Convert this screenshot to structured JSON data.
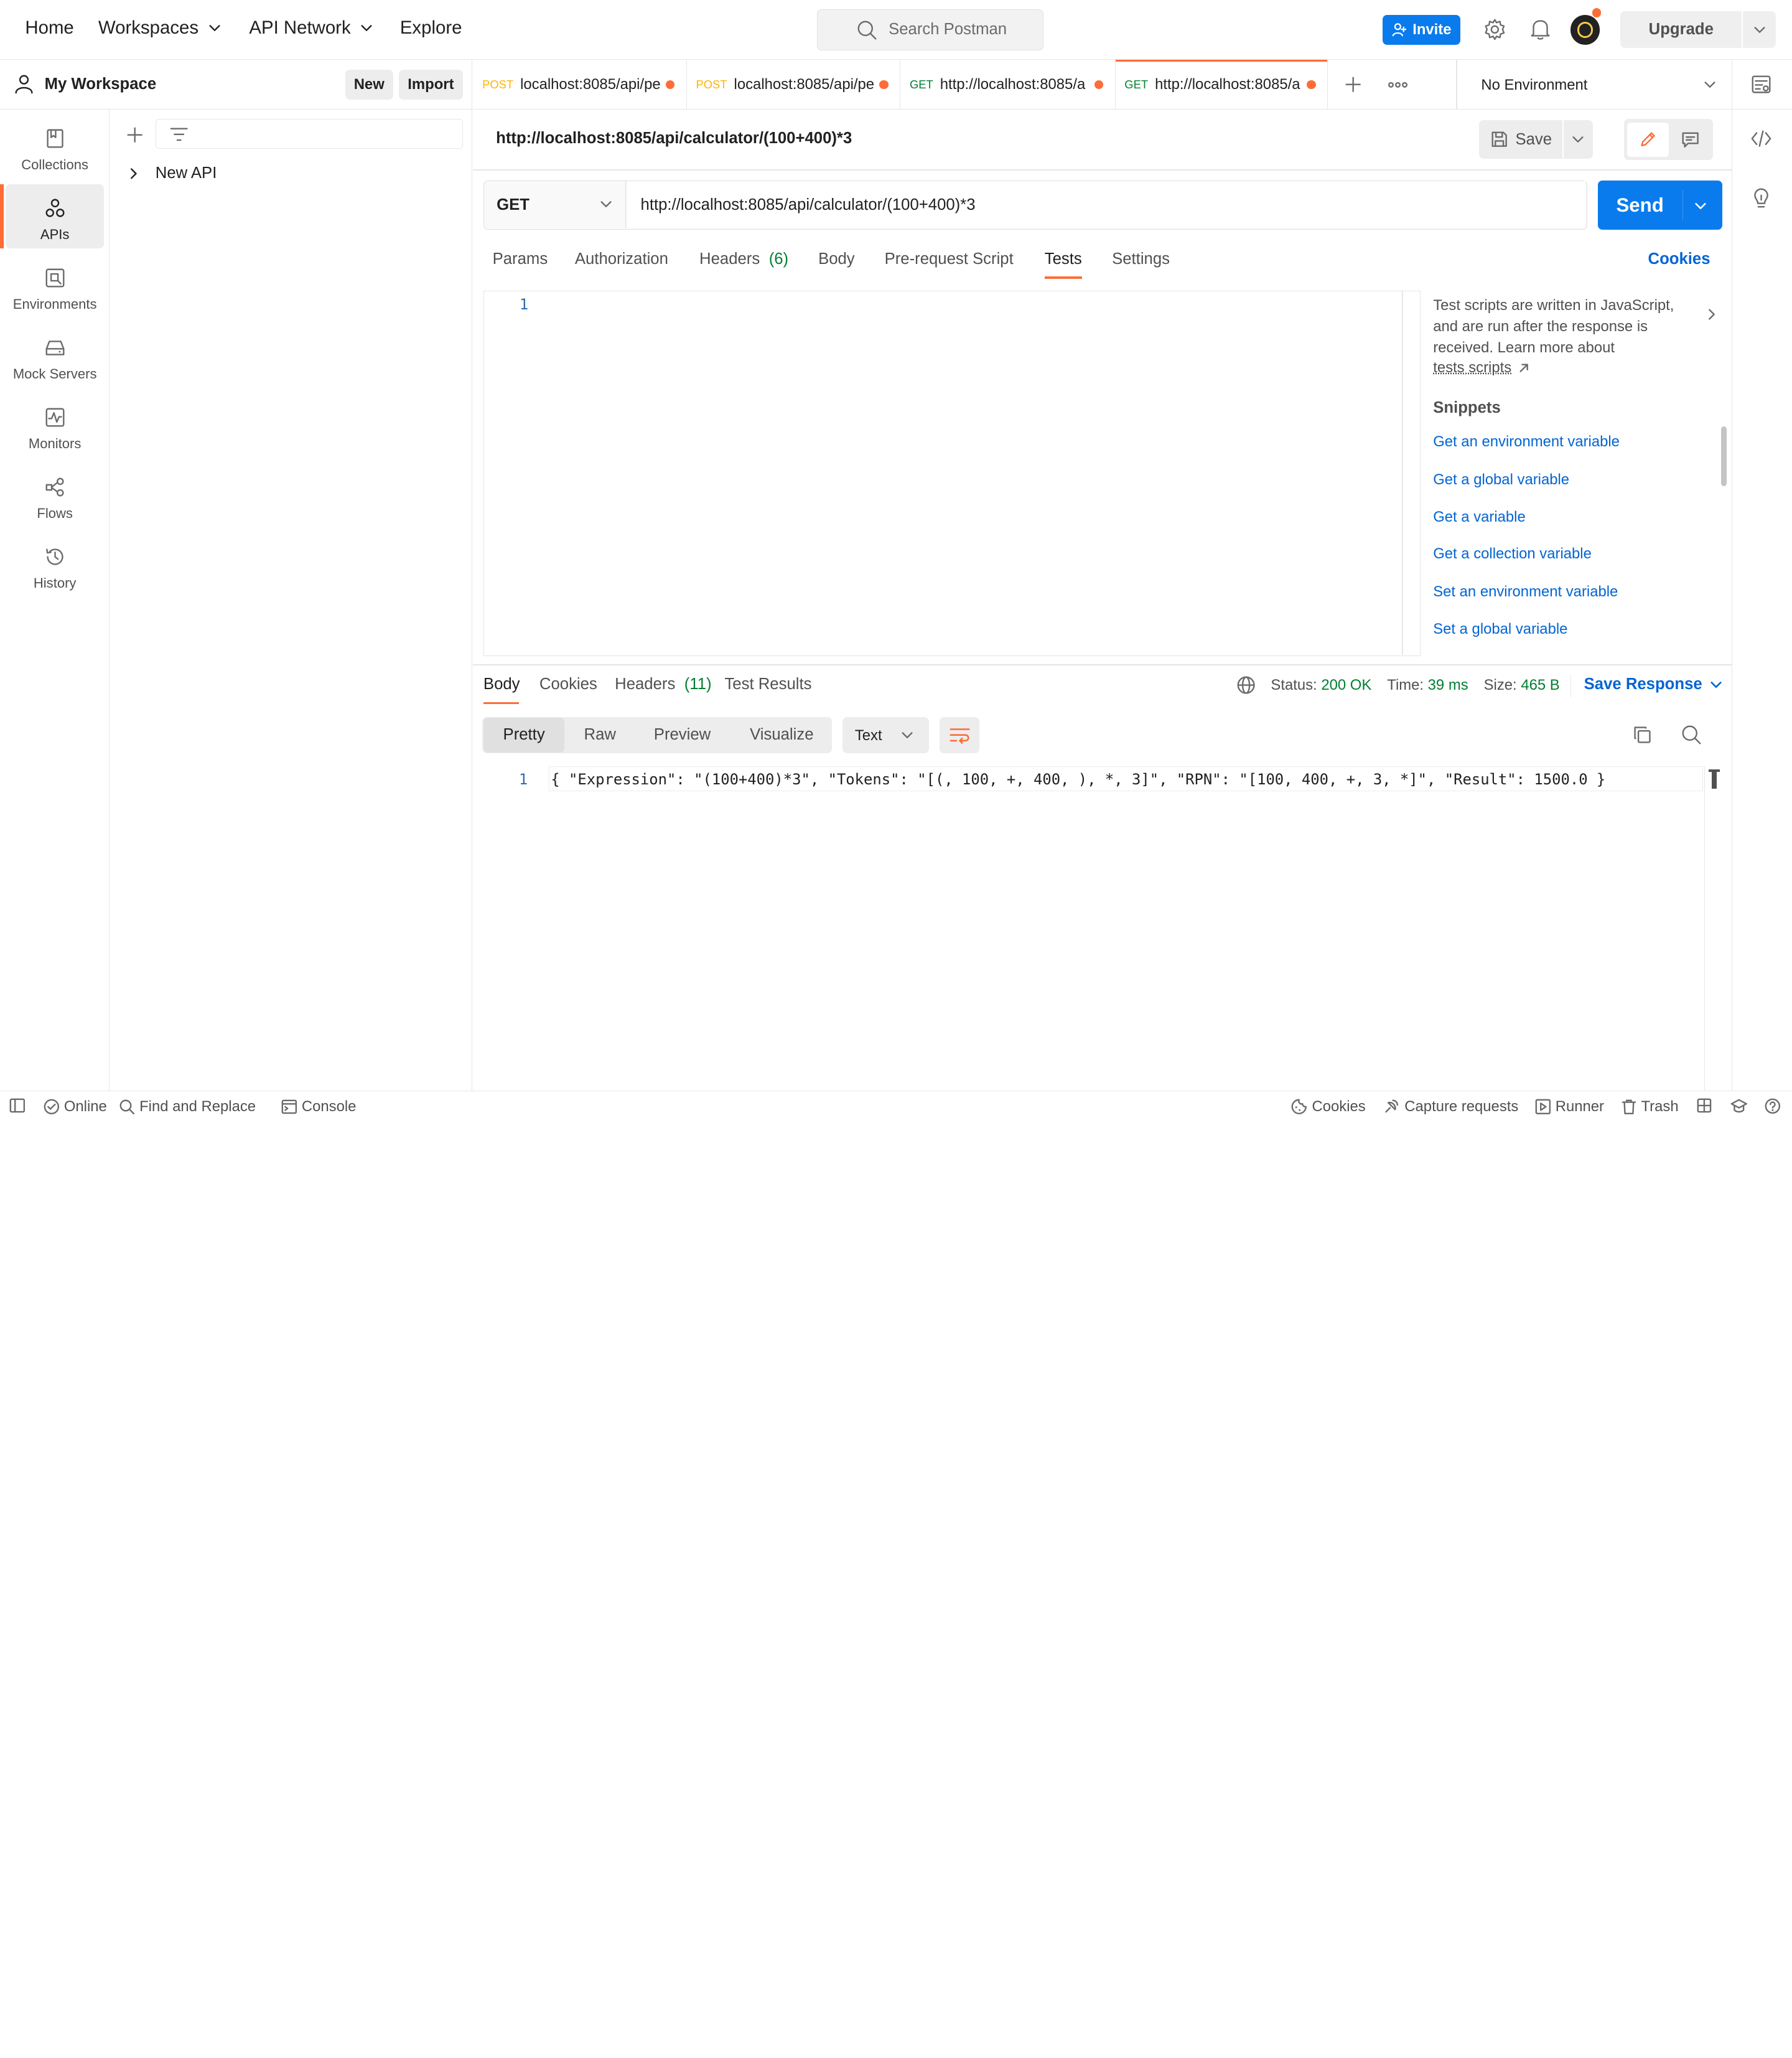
{
  "topbar": {
    "home": "Home",
    "workspaces": "Workspaces",
    "api_network": "API Network",
    "explore": "Explore",
    "search_placeholder": "Search Postman",
    "invite": "Invite",
    "upgrade": "Upgrade"
  },
  "workspace": {
    "title": "My Workspace",
    "new_label": "New",
    "import_label": "Import"
  },
  "rail": [
    {
      "label": "Collections",
      "icon": "collections-icon"
    },
    {
      "label": "APIs",
      "icon": "apis-icon"
    },
    {
      "label": "Environments",
      "icon": "environments-icon"
    },
    {
      "label": "Mock Servers",
      "icon": "mock-servers-icon"
    },
    {
      "label": "Monitors",
      "icon": "monitors-icon"
    },
    {
      "label": "Flows",
      "icon": "flows-icon"
    },
    {
      "label": "History",
      "icon": "history-icon"
    }
  ],
  "tree": {
    "item": "New API"
  },
  "tabs": [
    {
      "method": "POST",
      "label": "localhost:8085/api/pe"
    },
    {
      "method": "POST",
      "label": "localhost:8085/api/pe"
    },
    {
      "method": "GET",
      "label": "http://localhost:8085/a"
    },
    {
      "method": "GET",
      "label": "http://localhost:8085/a"
    }
  ],
  "environment": "No Environment",
  "request": {
    "title": "http://localhost:8085/api/calculator/(100+400)*3",
    "save_label": "Save",
    "method": "GET",
    "url": "http://localhost:8085/api/calculator/(100+400)*3",
    "send_label": "Send",
    "subtabs": {
      "params": "Params",
      "authorization": "Authorization",
      "headers": "Headers",
      "headers_count": "(6)",
      "body": "Body",
      "prerequest": "Pre-request Script",
      "tests": "Tests",
      "settings": "Settings",
      "cookies": "Cookies"
    },
    "editor_line": "1"
  },
  "help": {
    "text": "Test scripts are written in JavaScript, and are run after the response is received. Learn more about",
    "link": "tests scripts",
    "snippets_title": "Snippets",
    "snippets": [
      "Get an environment variable",
      "Get a global variable",
      "Get a variable",
      "Get a collection variable",
      "Set an environment variable",
      "Set a global variable"
    ]
  },
  "response": {
    "tabs": {
      "body": "Body",
      "cookies": "Cookies",
      "headers": "Headers",
      "headers_count": "(11)",
      "test_results": "Test Results"
    },
    "status_label": "Status:",
    "status_value": "200 OK",
    "time_label": "Time:",
    "time_value": "39 ms",
    "size_label": "Size:",
    "size_value": "465 B",
    "save_response": "Save Response",
    "views": {
      "pretty": "Pretty",
      "raw": "Raw",
      "preview": "Preview",
      "visualize": "Visualize"
    },
    "format": "Text",
    "line_no": "1",
    "body_text": "{ \"Expression\": \"(100+400)*3\", \"Tokens\": \"[(, 100, +, 400, ), *, 3]\", \"RPN\": \"[100, 400, +, 3, *]\", \"Result\": 1500.0 }"
  },
  "statusbar": {
    "online": "Online",
    "find_replace": "Find and Replace",
    "console": "Console",
    "cookies": "Cookies",
    "capture": "Capture requests",
    "runner": "Runner",
    "trash": "Trash"
  },
  "colors": {
    "accent": "#ff6c37",
    "primary": "#097bed",
    "success": "#007f31",
    "link": "#0265d2",
    "post": "#ffb400",
    "get": "#007f31"
  }
}
